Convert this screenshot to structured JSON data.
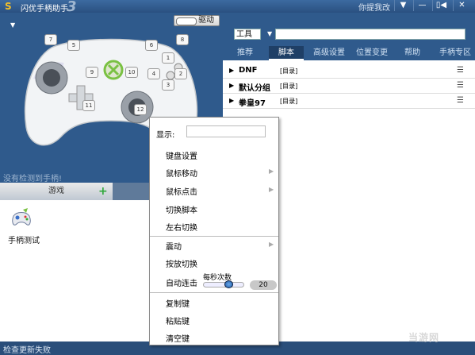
{
  "titlebar": {
    "logo": "S",
    "title": "闪优手柄助手",
    "version_mark": "3",
    "feedback": "你提我改",
    "buttons": [
      "▼",
      "—",
      "▯◀",
      "✕"
    ]
  },
  "left": {
    "driver_label": "驱动",
    "no_gamepad": "没有检测到手柄!",
    "keys": [
      "7",
      "5",
      "6",
      "8",
      "1",
      "2",
      "3",
      "4",
      "9",
      "10",
      "11",
      "12"
    ],
    "tab_game": "游戏",
    "tab_add": "+",
    "game_label": "手柄测试"
  },
  "toolbar": {
    "tools_label": "工具",
    "tools_input_value": ""
  },
  "nav": {
    "tabs": [
      {
        "label": "推荐"
      },
      {
        "label": "脚本"
      },
      {
        "label": "高级设置"
      },
      {
        "label": "位置变更"
      },
      {
        "label": "帮助"
      },
      {
        "label": "手柄专区"
      }
    ],
    "active": "脚本"
  },
  "scripts": [
    {
      "name": "DNF",
      "tag": "[目录]"
    },
    {
      "name": "默认分组",
      "tag": "[目录]"
    },
    {
      "name": "拳皇97",
      "tag": "[目录]"
    }
  ],
  "context_menu": {
    "display_label": "显示:",
    "display_value": "",
    "items": {
      "keyboard_settings": "键盘设置",
      "mouse_move": "鼠标移动",
      "mouse_click": "鼠标点击",
      "switch_script": "切换脚本",
      "lr_switch": "左右切换",
      "vibration": "震动",
      "press_release_switch": "按放切换",
      "auto_fire": "自动连击",
      "per_second_label": "每秒次数",
      "per_second_value": "20",
      "copy_key": "复制键",
      "paste_key": "粘贴键",
      "clear_key": "清空键"
    }
  },
  "status": {
    "text": "检查更新失败"
  },
  "watermark": "当游网",
  "colors": {
    "frame": "#2f5a8c",
    "title_bar": "#2a4e7a",
    "accent_green": "#2fa83a",
    "xbox_green": "#7ac142"
  }
}
